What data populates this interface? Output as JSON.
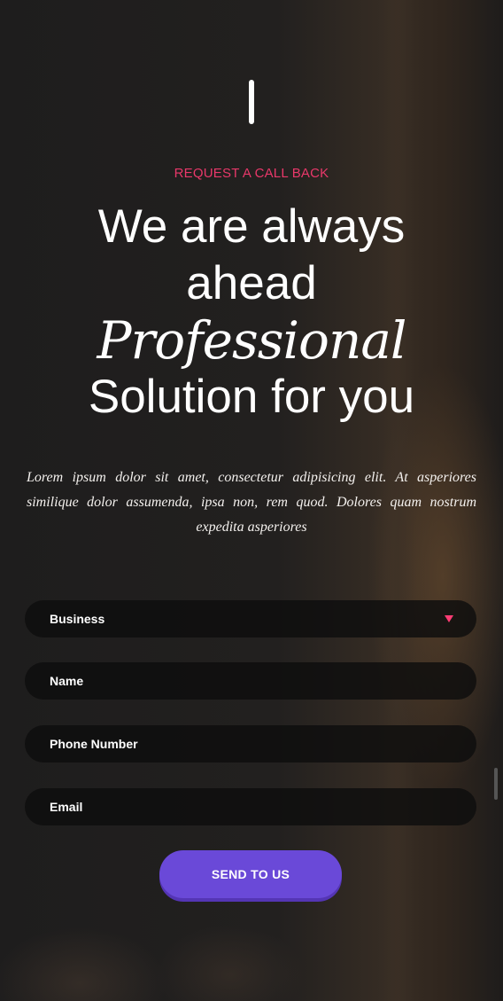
{
  "hero": {
    "eyebrow": "REQUEST A CALL BACK",
    "headline_line1": "We are always",
    "headline_line2": "ahead",
    "headline_italic": "Professional",
    "headline_line4": "Solution for you",
    "description": "Lorem ipsum dolor sit amet, consectetur adipisicing elit. At asperiores similique dolor assumenda, ipsa non, rem quod. Dolores quam nostrum expedita asperiores"
  },
  "form": {
    "business_select": "Business",
    "name_placeholder": "Name",
    "phone_placeholder": "Phone Number",
    "email_placeholder": "Email",
    "submit_label": "SEND TO US"
  },
  "colors": {
    "accent": "#e9386a",
    "button": "#6a49d8",
    "field_bg": "#0e0d0d"
  },
  "icons": {
    "select_caret": "caret-down-icon"
  }
}
